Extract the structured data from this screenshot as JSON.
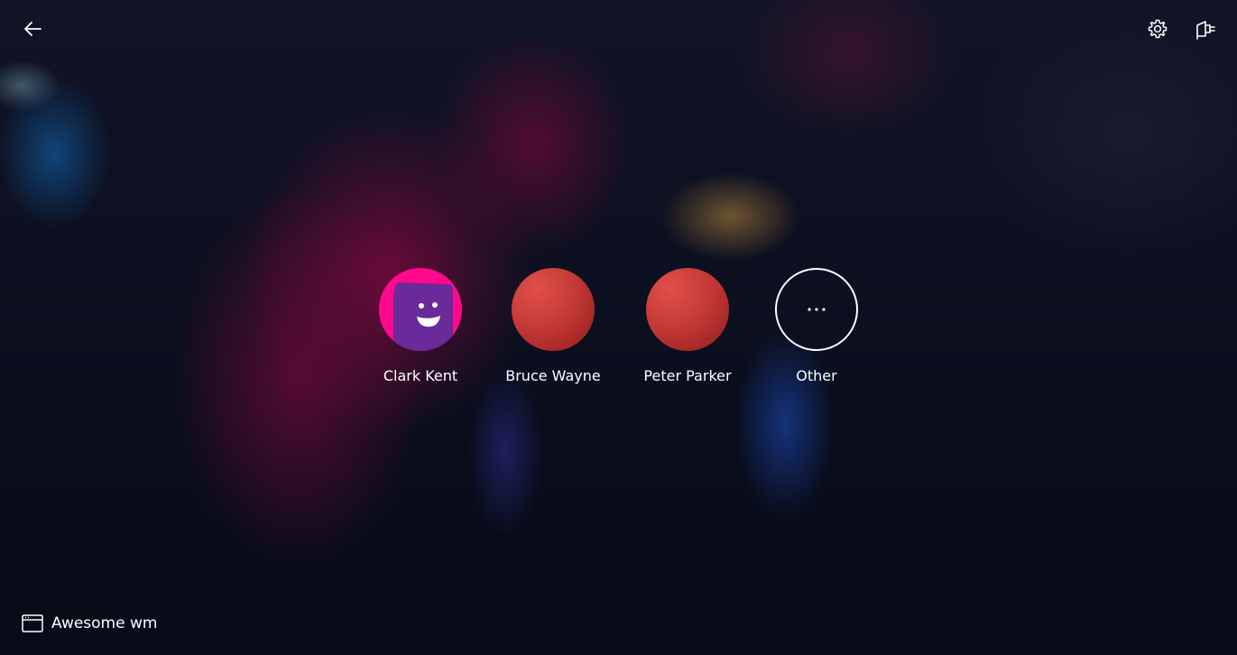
{
  "header": {
    "back_icon": "arrow-left-icon",
    "settings_icon": "gear-icon",
    "power_icon": "power-plug-icon"
  },
  "users": [
    {
      "name": "Clark Kent",
      "avatar": "purple-smiley-on-pink"
    },
    {
      "name": "Bruce Wayne",
      "avatar": "red-circle"
    },
    {
      "name": "Peter Parker",
      "avatar": "red-circle"
    },
    {
      "name": "Other",
      "avatar": "ellipsis-icon"
    }
  ],
  "session": {
    "icon": "window-icon",
    "label": "Awesome wm"
  },
  "colors": {
    "text": "#ffffff",
    "avatar_red": "#c63a36",
    "avatar_pink": "#ff0a8c",
    "avatar_purple": "#6a2a9a",
    "background": "#0b1020"
  }
}
